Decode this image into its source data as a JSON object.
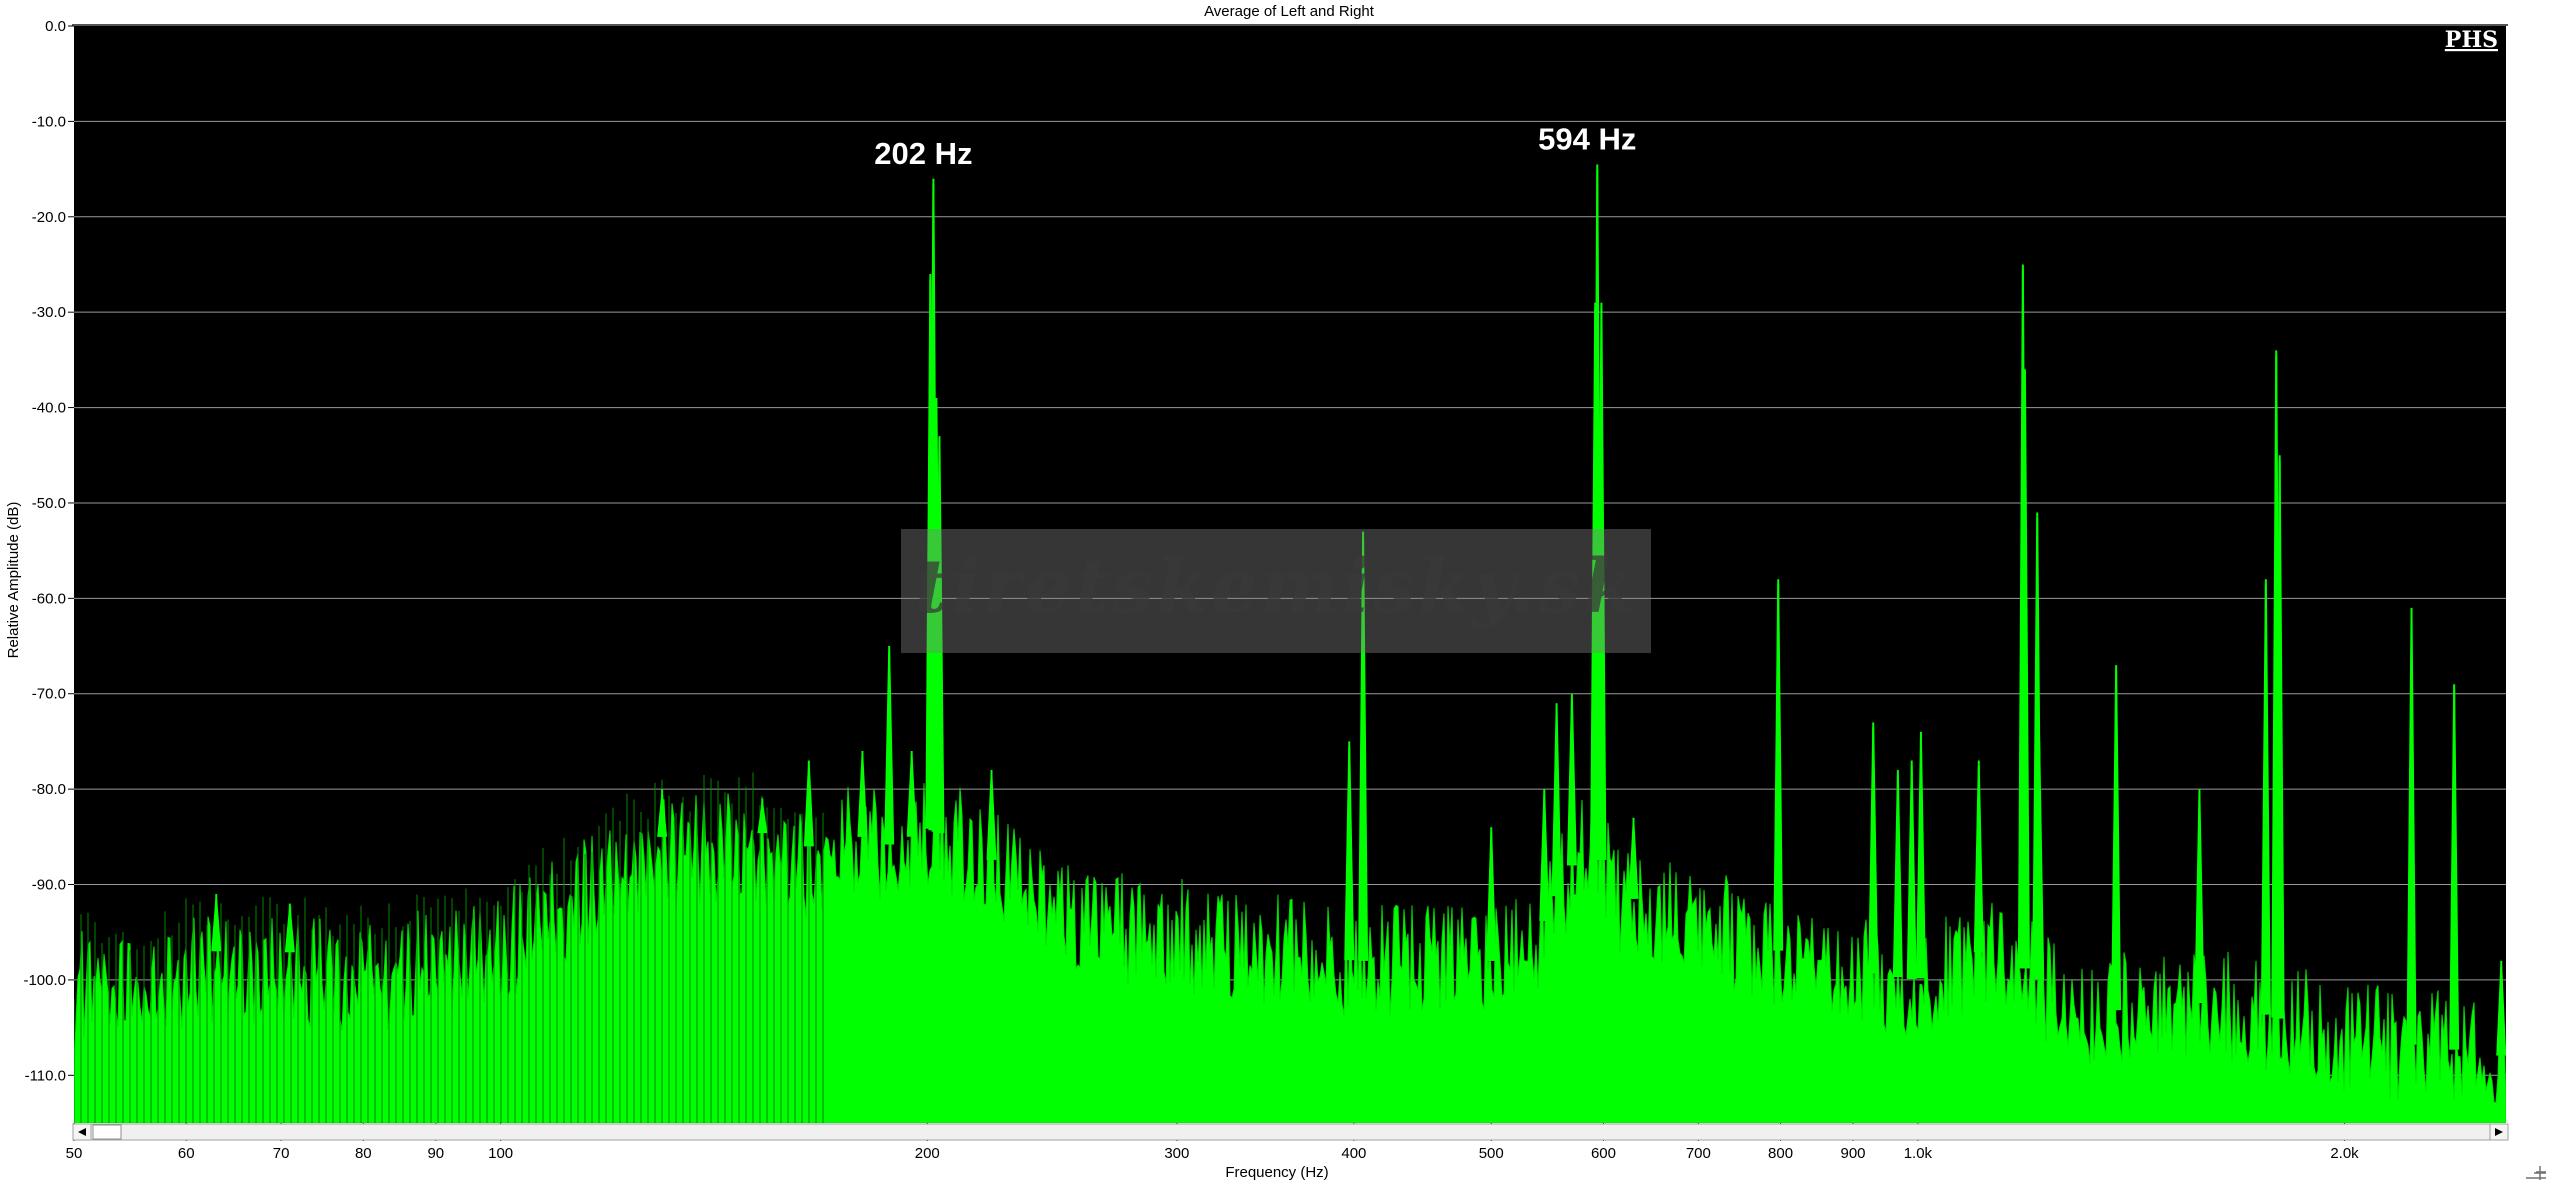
{
  "window": {
    "scroll_left_icon": "arrow-left-icon",
    "scroll_right_icon": "arrow-right-icon",
    "corner_icon": "resize-grip-icon"
  },
  "chart_data": {
    "type": "area",
    "title": "Average of Left and Right",
    "xlabel": "Frequency (Hz)",
    "ylabel": "Relative Amplitude (dB)",
    "x_scale": "log",
    "xlim": [
      50,
      2600
    ],
    "ylim": [
      -115,
      0
    ],
    "grid": "horizontal",
    "background": "#000000",
    "series_color": "#00ff00",
    "logo": "PHS",
    "watermark": "tiretskemisky.sk",
    "x_ticks": [
      {
        "value": 50,
        "label": "50"
      },
      {
        "value": 60,
        "label": "60"
      },
      {
        "value": 70,
        "label": "70"
      },
      {
        "value": 80,
        "label": "80"
      },
      {
        "value": 90,
        "label": "90"
      },
      {
        "value": 100,
        "label": "100"
      },
      {
        "value": 200,
        "label": "200"
      },
      {
        "value": 300,
        "label": "300"
      },
      {
        "value": 400,
        "label": "400"
      },
      {
        "value": 500,
        "label": "500"
      },
      {
        "value": 600,
        "label": "600"
      },
      {
        "value": 700,
        "label": "700"
      },
      {
        "value": 800,
        "label": "800"
      },
      {
        "value": 900,
        "label": "900"
      },
      {
        "value": 1000,
        "label": "1.0k"
      },
      {
        "value": 2000,
        "label": "2.0k"
      }
    ],
    "y_ticks": [
      {
        "value": 0,
        "label": "0.0"
      },
      {
        "value": -10,
        "label": "-10.0"
      },
      {
        "value": -20,
        "label": "-20.0"
      },
      {
        "value": -30,
        "label": "-30.0"
      },
      {
        "value": -40,
        "label": "-40.0"
      },
      {
        "value": -50,
        "label": "-50.0"
      },
      {
        "value": -60,
        "label": "-60.0"
      },
      {
        "value": -70,
        "label": "-70.0"
      },
      {
        "value": -80,
        "label": "-80.0"
      },
      {
        "value": -90,
        "label": "-90.0"
      },
      {
        "value": -100,
        "label": "-100.0"
      },
      {
        "value": -110,
        "label": "-110.0"
      }
    ],
    "annotations": [
      {
        "text": "202 Hz",
        "x": 202,
        "y": -13
      },
      {
        "text": "594 Hz",
        "x": 594,
        "y": -11.5
      }
    ],
    "noise_floor": [
      [
        50,
        -98
      ],
      [
        55,
        -99
      ],
      [
        60,
        -97
      ],
      [
        70,
        -97
      ],
      [
        80,
        -98
      ],
      [
        90,
        -96
      ],
      [
        100,
        -95
      ],
      [
        110,
        -91
      ],
      [
        120,
        -87
      ],
      [
        130,
        -85
      ],
      [
        140,
        -84
      ],
      [
        150,
        -84
      ],
      [
        160,
        -86
      ],
      [
        170,
        -86
      ],
      [
        180,
        -85
      ],
      [
        190,
        -86
      ],
      [
        200,
        -84
      ],
      [
        220,
        -87
      ],
      [
        240,
        -91
      ],
      [
        260,
        -94
      ],
      [
        280,
        -95
      ],
      [
        300,
        -95
      ],
      [
        330,
        -97
      ],
      [
        360,
        -97
      ],
      [
        400,
        -98
      ],
      [
        450,
        -98
      ],
      [
        500,
        -98
      ],
      [
        540,
        -95
      ],
      [
        570,
        -88
      ],
      [
        590,
        -85
      ],
      [
        610,
        -91
      ],
      [
        650,
        -92
      ],
      [
        700,
        -93
      ],
      [
        760,
        -96
      ],
      [
        800,
        -97
      ],
      [
        900,
        -99
      ],
      [
        1000,
        -100
      ],
      [
        1100,
        -97
      ],
      [
        1200,
        -99
      ],
      [
        1300,
        -104
      ],
      [
        1500,
        -102
      ],
      [
        1700,
        -103
      ],
      [
        2000,
        -106
      ],
      [
        2300,
        -107
      ],
      [
        2600,
        -108
      ]
    ],
    "peaks": [
      {
        "x": 63,
        "y": -91
      },
      {
        "x": 71,
        "y": -92
      },
      {
        "x": 130,
        "y": -80
      },
      {
        "x": 153,
        "y": -81
      },
      {
        "x": 165,
        "y": -77
      },
      {
        "x": 180,
        "y": -76
      },
      {
        "x": 188,
        "y": -65
      },
      {
        "x": 195,
        "y": -76
      },
      {
        "x": 201,
        "y": -26
      },
      {
        "x": 202,
        "y": -16
      },
      {
        "x": 203,
        "y": -39
      },
      {
        "x": 204,
        "y": -43
      },
      {
        "x": 222,
        "y": -78
      },
      {
        "x": 397,
        "y": -75
      },
      {
        "x": 406,
        "y": -53
      },
      {
        "x": 500,
        "y": -84
      },
      {
        "x": 545,
        "y": -80
      },
      {
        "x": 556,
        "y": -71
      },
      {
        "x": 570,
        "y": -70
      },
      {
        "x": 592,
        "y": -29
      },
      {
        "x": 594,
        "y": -14.5
      },
      {
        "x": 598,
        "y": -29
      },
      {
        "x": 630,
        "y": -83
      },
      {
        "x": 797,
        "y": -58
      },
      {
        "x": 930,
        "y": -73
      },
      {
        "x": 968,
        "y": -78
      },
      {
        "x": 990,
        "y": -77
      },
      {
        "x": 1005,
        "y": -74
      },
      {
        "x": 1104,
        "y": -77
      },
      {
        "x": 1186,
        "y": -25
      },
      {
        "x": 1190,
        "y": -36
      },
      {
        "x": 1214,
        "y": -51
      },
      {
        "x": 1218,
        "y": -75
      },
      {
        "x": 1380,
        "y": -67
      },
      {
        "x": 1580,
        "y": -80
      },
      {
        "x": 1760,
        "y": -58
      },
      {
        "x": 1790,
        "y": -34
      },
      {
        "x": 1800,
        "y": -45
      },
      {
        "x": 2230,
        "y": -61
      },
      {
        "x": 2390,
        "y": -69
      },
      {
        "x": 2580,
        "y": -98
      }
    ]
  }
}
